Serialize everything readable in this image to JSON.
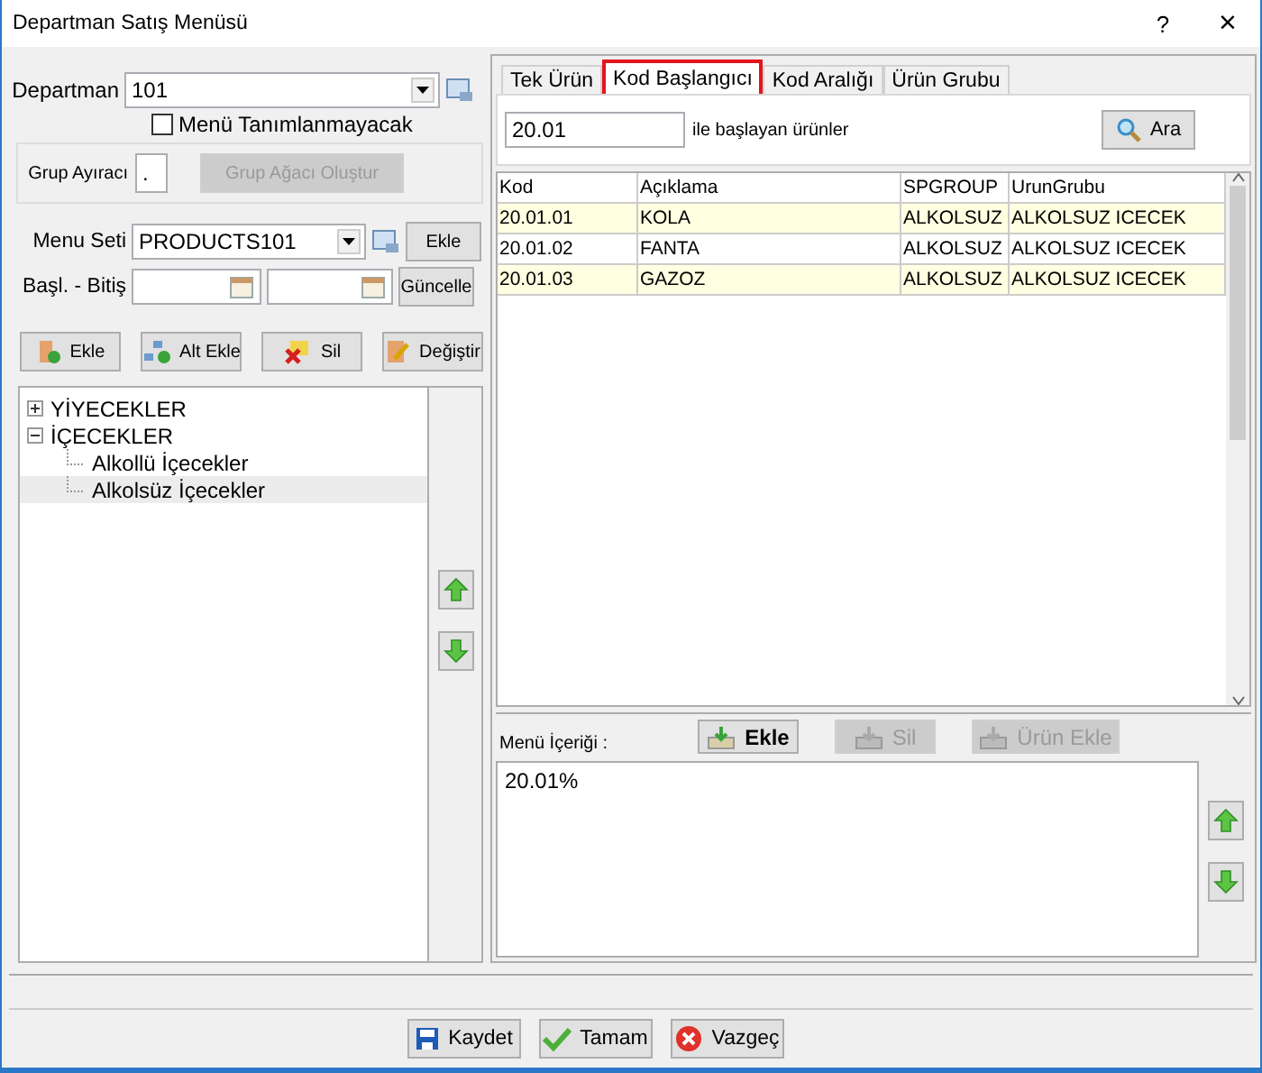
{
  "window": {
    "title": "Departman Satış Menüsü",
    "help": "?",
    "close": "×"
  },
  "department": {
    "label": "Departman",
    "value": "101"
  },
  "no_menu": {
    "label": "Menü Tanımlanmayacak",
    "checked": false
  },
  "group_separator": {
    "label": "Grup Ayıracı",
    "value": ".",
    "build_button": {
      "label": "Grup Ağacı Oluştur",
      "disabled": true
    }
  },
  "menu_set": {
    "label": "Menu Seti",
    "value": "PRODUCTS101",
    "button": "Ekle"
  },
  "date_range": {
    "label": "Başl. - Bitiş",
    "button": "Güncelle"
  },
  "tree_buttons": [
    {
      "label": "Ekle",
      "kind": "add"
    },
    {
      "label": "Alt Ekle",
      "kind": "sub"
    },
    {
      "label": "Sil",
      "kind": "delete"
    },
    {
      "label": "Değiştir",
      "kind": "edit"
    }
  ],
  "tree": [
    {
      "label": "YİYECEKLER",
      "expanded": false,
      "selected": false
    },
    {
      "label": "İÇECEKLER",
      "expanded": true,
      "selected": false,
      "children": [
        {
          "label": "Alkollü İçecekler",
          "selected": false
        },
        {
          "label": "Alkolsüz İçecekler",
          "selected": true
        }
      ]
    }
  ],
  "tabs": [
    {
      "label": "Tek Ürün",
      "selected": false
    },
    {
      "label": "Kod Başlangıcı",
      "selected": true
    },
    {
      "label": "Kod Aralığı",
      "selected": false
    },
    {
      "label": "Ürün Grubu",
      "selected": false
    }
  ],
  "search": {
    "value": "20.01",
    "suffix": "ile başlayan ürünler",
    "button": "Ara"
  },
  "table": {
    "columns": [
      "Kod",
      "Açıklama",
      "SPGROUP",
      "UrunGrubu"
    ],
    "rows": [
      [
        "20.01.01",
        "KOLA",
        "ALKOLSUZ",
        "ALKOLSUZ ICECEK"
      ],
      [
        "20.01.02",
        "FANTA",
        "ALKOLSUZ",
        "ALKOLSUZ ICECEK"
      ],
      [
        "20.01.03",
        "GAZOZ",
        "ALKOLSUZ",
        "ALKOLSUZ ICECEK"
      ]
    ]
  },
  "menu_content": {
    "label": "Menü İçeriği :",
    "buttons": [
      {
        "label": "Ekle",
        "disabled": false
      },
      {
        "label": "Sil",
        "disabled": true
      },
      {
        "label": "Ürün Ekle",
        "disabled": true
      }
    ],
    "items": [
      "20.01%"
    ]
  },
  "footer_buttons": [
    {
      "label": "Kaydet",
      "kind": "save"
    },
    {
      "label": "Tamam",
      "kind": "ok"
    },
    {
      "label": "Vazgeç",
      "kind": "cancel"
    }
  ]
}
